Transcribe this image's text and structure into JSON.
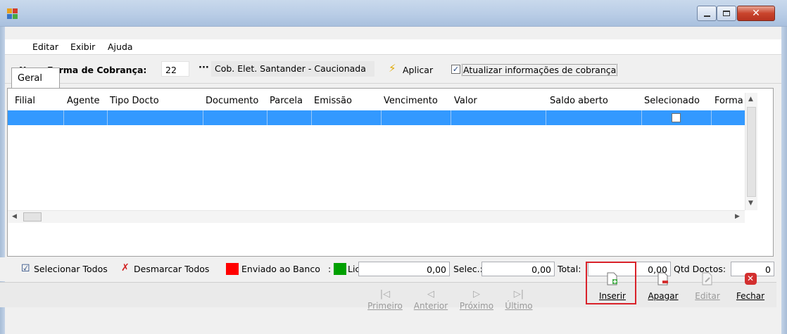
{
  "menu": {
    "items": [
      "Editar",
      "Exibir",
      "Ajuda"
    ]
  },
  "top": {
    "label": "Nova Forma de Cobrança:",
    "code": "22",
    "lookup_button": "···",
    "description": "Cob. Elet. Santander - Caucionada",
    "apply_label": "Aplicar",
    "update_info_label": "Atualizar informações de cobrança",
    "update_info_checked": true
  },
  "tabs": [
    "Geral"
  ],
  "grid": {
    "columns": [
      "Filial",
      "Agente",
      "Tipo Docto",
      "Documento",
      "Parcela",
      "Emissão",
      "Vencimento",
      "Valor",
      "Saldo aberto",
      "Selecionado",
      "Forma C("
    ],
    "rows": [
      {
        "selected": false
      }
    ]
  },
  "legend": {
    "select_all": "Selecionar Todos",
    "unselect_all": "Desmarcar Todos",
    "sent_bank": "Enviado ao Banco",
    "sent_bank_color": "#ff0000",
    "sep": ":",
    "settled": "Lic",
    "settled_color": "#00a000",
    "value1": "0,00",
    "selec_label": "Selec.:",
    "value2": "0,00",
    "total_label": "Total:",
    "value3": "0,00",
    "qtd_label": "Qtd Doctos:",
    "qtd_value": "0"
  },
  "nav": {
    "primeiro": "Primeiro",
    "anterior": "Anterior",
    "proximo": "Próximo",
    "ultimo": "Último",
    "inserir": "Inserir",
    "apagar": "Apagar",
    "editar": "Editar",
    "fechar": "Fechar"
  }
}
